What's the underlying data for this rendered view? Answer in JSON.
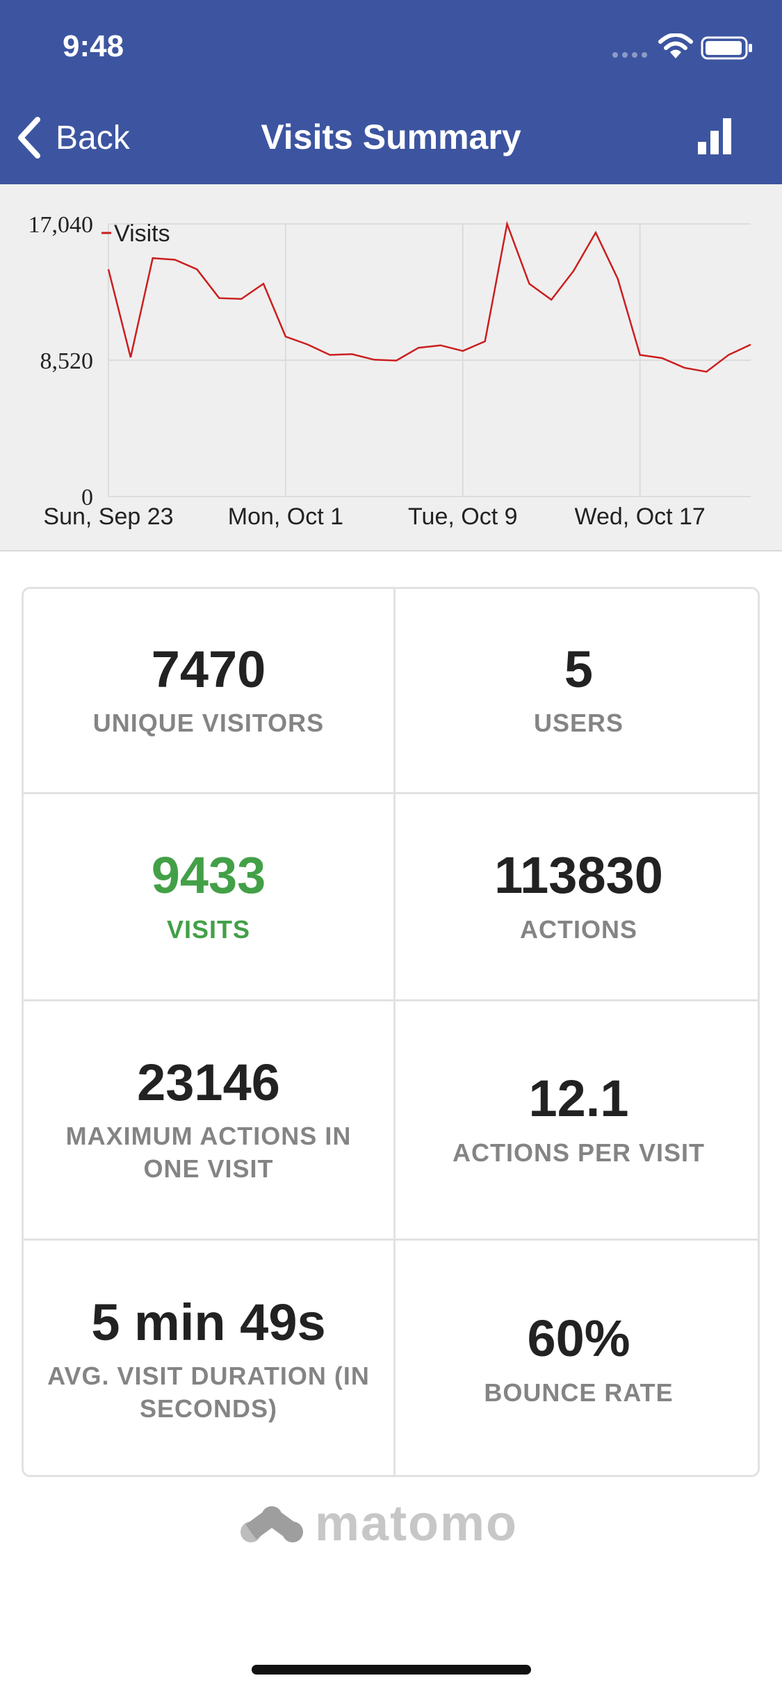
{
  "status_bar": {
    "time": "9:48"
  },
  "nav": {
    "back_label": "Back",
    "title": "Visits Summary"
  },
  "chart_data": {
    "type": "line",
    "legend": "Visits",
    "y_ticks": [
      "17,040",
      "8,520",
      "0"
    ],
    "ylim": [
      0,
      17040
    ],
    "x_ticks": [
      "Sun, Sep 23",
      "Mon, Oct 1",
      "Tue, Oct 9",
      "Wed, Oct 17"
    ],
    "series": [
      {
        "name": "Visits",
        "color": "#cc1e1e",
        "values": [
          14200,
          8700,
          14900,
          14800,
          14200,
          12400,
          12350,
          13300,
          10000,
          9500,
          8850,
          8900,
          8550,
          8500,
          9300,
          9450,
          9100,
          9700,
          17040,
          13300,
          12300,
          14100,
          16500,
          13600,
          8850,
          8650,
          8050,
          7800,
          8850,
          9500
        ]
      }
    ]
  },
  "stats": [
    {
      "value": "7470",
      "label": "UNIQUE VISITORS"
    },
    {
      "value": "5",
      "label": "USERS"
    },
    {
      "value": "9433",
      "label": "VISITS"
    },
    {
      "value": "113830",
      "label": "ACTIONS"
    },
    {
      "value": "23146",
      "label": "MAXIMUM ACTIONS IN ONE VISIT"
    },
    {
      "value": "12.1",
      "label": "ACTIONS PER VISIT"
    },
    {
      "value": "5 min 49s",
      "label": "AVG. VISIT DURATION (IN SECONDS)"
    },
    {
      "value": "60%",
      "label": "BOUNCE RATE"
    }
  ],
  "footer": {
    "logo_text": "matomo"
  }
}
